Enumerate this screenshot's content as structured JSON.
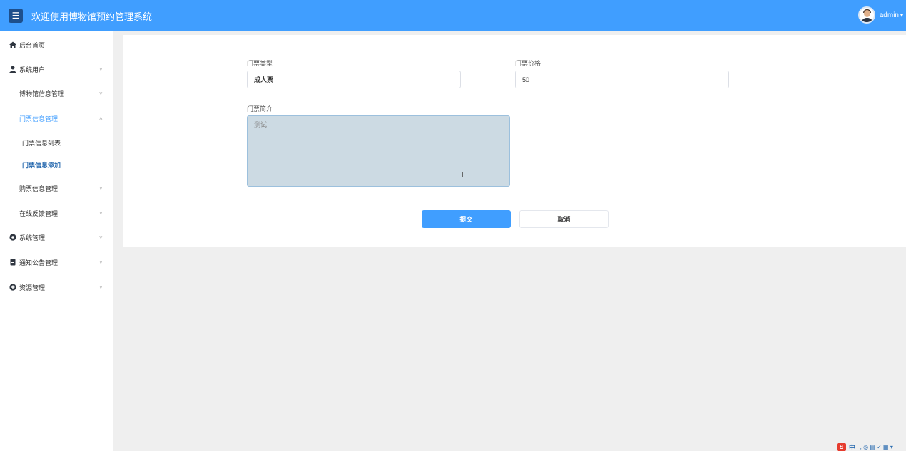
{
  "header": {
    "title": "欢迎使用博物馆预约管理系统",
    "user": "admin",
    "menu_icon": "☰"
  },
  "sidebar": {
    "items": [
      {
        "label": "后台首页",
        "icon": "home-icon"
      },
      {
        "label": "系统用户",
        "icon": "user-icon",
        "arrow": "˅"
      },
      {
        "label": "博物馆信息管理",
        "icon": "grid-icon",
        "arrow": "˅"
      },
      {
        "label": "门票信息管理",
        "icon": "grid-icon",
        "arrow": "˄",
        "active": true
      },
      {
        "label": "购票信息管理",
        "icon": "grid-icon",
        "arrow": "˅"
      },
      {
        "label": "在线反馈管理",
        "icon": "grid-icon",
        "arrow": "˅"
      },
      {
        "label": "系统管理",
        "icon": "gear-icon",
        "arrow": "˅"
      },
      {
        "label": "通知公告管理",
        "icon": "document-icon",
        "arrow": "˅"
      },
      {
        "label": "资源管理",
        "icon": "plus-circle-icon",
        "arrow": "˅"
      }
    ],
    "sub_items": [
      {
        "label": "门票信息列表"
      },
      {
        "label": "门票信息添加",
        "active": true
      }
    ]
  },
  "form": {
    "ticket_type_label": "门票类型",
    "ticket_type_value": "成人票",
    "ticket_price_label": "门票价格",
    "ticket_price_value": "50",
    "ticket_intro_label": "门票简介",
    "ticket_intro_value": "测试",
    "submit_label": "提交",
    "cancel_label": "取消"
  },
  "tray": {
    "input_logo": "S",
    "input_mode": "中",
    "icons": "·, ◎ ▤ ✓ ▦ ▾"
  },
  "colors": {
    "primary": "#409eff",
    "background": "#efefef"
  }
}
